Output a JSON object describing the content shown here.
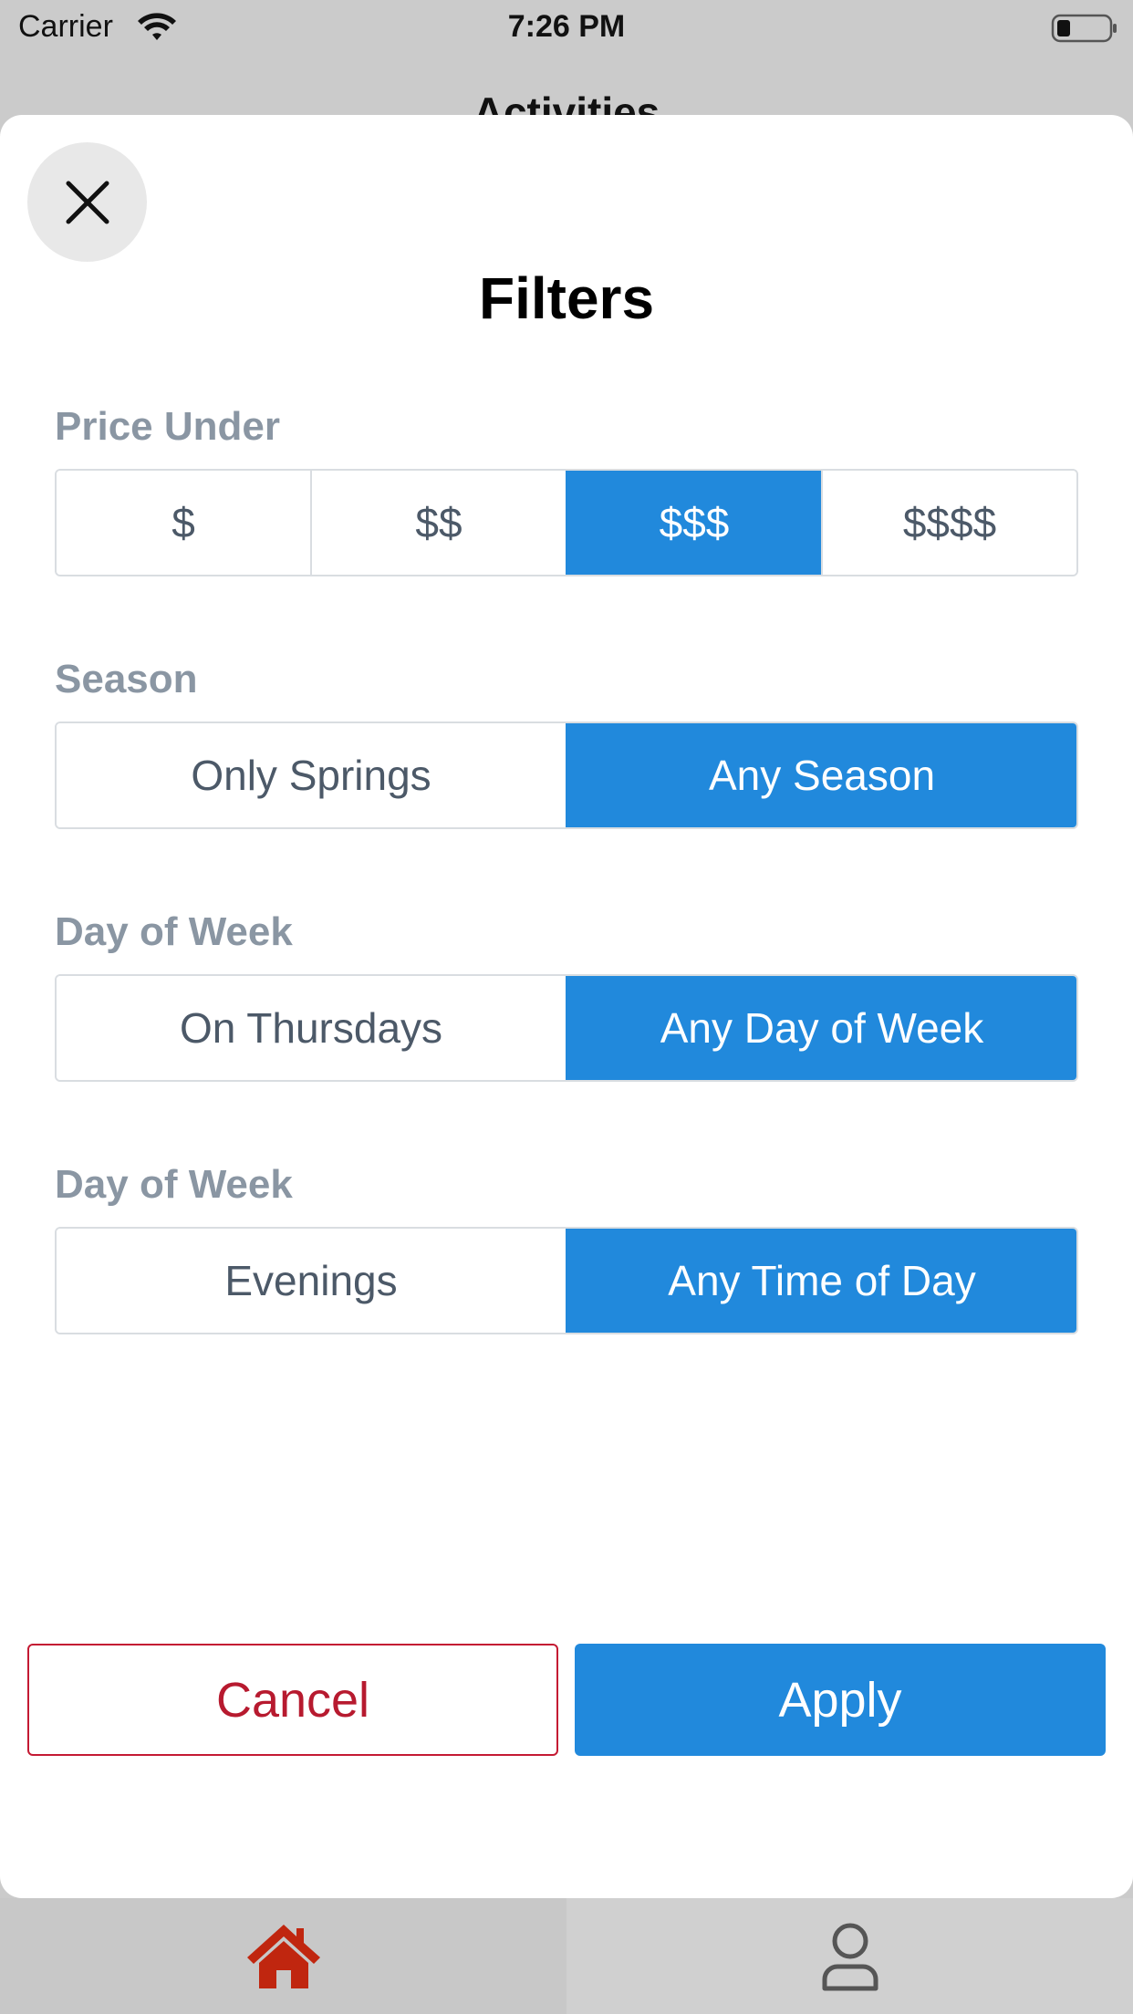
{
  "status_bar": {
    "carrier": "Carrier",
    "time": "7:26 PM",
    "wifi_icon": "wifi-icon",
    "battery_icon": "battery-icon"
  },
  "background": {
    "nav_title": "Activities"
  },
  "sheet": {
    "title": "Filters",
    "close_icon": "close-icon",
    "groups": [
      {
        "label": "Price Under",
        "options": [
          "$",
          "$$",
          "$$$",
          "$$$$"
        ],
        "selected": "$$$"
      },
      {
        "label": "Season",
        "options": [
          "Only Springs",
          "Any Season"
        ],
        "selected": "Any Season"
      },
      {
        "label": "Day of Week",
        "options": [
          "On Thursdays",
          "Any Day of Week"
        ],
        "selected": "Any Day of Week"
      },
      {
        "label": "Day of Week",
        "options": [
          "Evenings",
          "Any Time of Day"
        ],
        "selected": "Any Time of Day"
      }
    ],
    "cancel_label": "Cancel",
    "apply_label": "Apply"
  },
  "tab_bar": {
    "items": [
      {
        "name": "home",
        "icon": "home-icon",
        "active": true
      },
      {
        "name": "profile",
        "icon": "user-icon",
        "active": false
      }
    ]
  },
  "colors": {
    "accent": "#2189dc",
    "cancel": "#b71a2f",
    "home_active": "#c0260f",
    "inactive_icon": "#555555",
    "group_label": "#8a96a3"
  }
}
